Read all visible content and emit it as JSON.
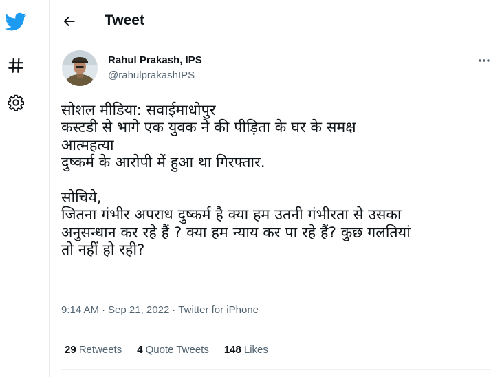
{
  "nav": {
    "items": [
      {
        "icon": "twitter-bird-icon",
        "color": "#1d9bf0"
      },
      {
        "icon": "hashtag-icon"
      },
      {
        "icon": "gear-icon"
      }
    ]
  },
  "header": {
    "title": "Tweet",
    "back_icon": "arrow-left-icon"
  },
  "tweet": {
    "author": {
      "name": "Rahul Prakash, IPS",
      "handle": "@rahulprakashIPS"
    },
    "lines": [
      "सोशल मीडिया: सवाईमाधोपुर",
      "कस्टडी से भागे एक युवक ने की पीड़िता के घर के समक्ष",
      "आत्महत्या",
      "दुष्कर्म के आरोपी में हुआ था गिरफ्तार.",
      "सोचिये,",
      "जितना गंभीर अपराध दुष्कर्म है क्या हम उतनी गंभीरता से उसका",
      "अनुसन्धान कर रहे हैं ? क्या हम न्याय कर पा रहे हैं? कुछ गलतियां",
      "तो नहीं हो रही?"
    ],
    "time": "9:14 AM",
    "date": "Sep 21, 2022",
    "separator": "·",
    "client": "Twitter for iPhone",
    "stats": {
      "retweets_count": "29",
      "retweets_label": "Retweets",
      "quotes_count": "4",
      "quotes_label": "Quote Tweets",
      "likes_count": "148",
      "likes_label": "Likes"
    }
  },
  "colors": {
    "accent": "#1d9bf0",
    "text_primary": "#0f1419",
    "text_secondary": "#536471"
  }
}
